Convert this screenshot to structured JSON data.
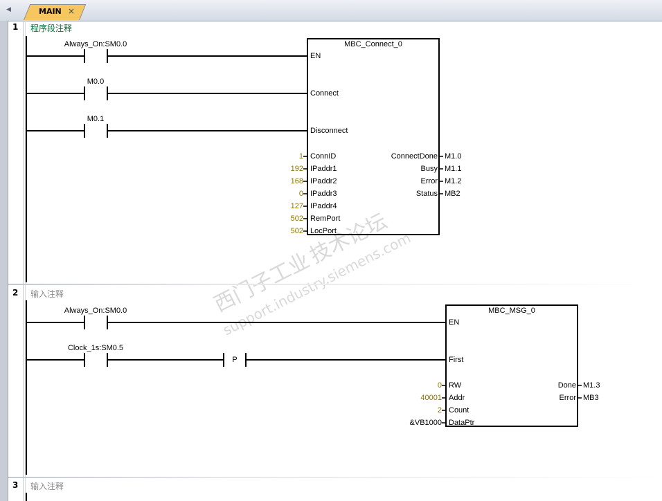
{
  "editor": {
    "tab_label": "MAIN",
    "tab_close": "×",
    "scroll_left": "◀"
  },
  "watermark": {
    "line1": "西门子工业",
    "line2": "技术论坛",
    "line3": "support.industry.siemens.com"
  },
  "network1": {
    "number": "1",
    "comment": "程序段注释",
    "contacts": [
      "Always_On:SM0.0",
      "M0.0",
      "M0.1"
    ],
    "block": {
      "title": "MBC_Connect_0",
      "en": "EN",
      "connect": "Connect",
      "disconnect": "Disconnect",
      "inputs": [
        {
          "pin": "ConnID",
          "value": "1"
        },
        {
          "pin": "IPaddr1",
          "value": "192"
        },
        {
          "pin": "IPaddr2",
          "value": "168"
        },
        {
          "pin": "IPaddr3",
          "value": "0"
        },
        {
          "pin": "IPaddr4",
          "value": "127"
        },
        {
          "pin": "RemPort",
          "value": "502"
        },
        {
          "pin": "LocPort",
          "value": "502"
        }
      ],
      "outputs": [
        {
          "pin": "ConnectDone",
          "value": "M1.0"
        },
        {
          "pin": "Busy",
          "value": "M1.1"
        },
        {
          "pin": "Error",
          "value": "M1.2"
        },
        {
          "pin": "Status",
          "value": "MB2"
        }
      ]
    }
  },
  "network2": {
    "number": "2",
    "comment": "输入注释",
    "contacts": [
      "Always_On:SM0.0",
      "Clock_1s:SM0.5"
    ],
    "pulse_label": "P",
    "block": {
      "title": "MBC_MSG_0",
      "en": "EN",
      "first": "First",
      "inputs": [
        {
          "pin": "RW",
          "value": "0",
          "color": "#8a7400"
        },
        {
          "pin": "Addr",
          "value": "40001",
          "color": "#8a7400"
        },
        {
          "pin": "Count",
          "value": "2",
          "color": "#8a7400"
        },
        {
          "pin": "DataPtr",
          "value": "&VB1000",
          "color": "#000000"
        }
      ],
      "outputs": [
        {
          "pin": "Done",
          "value": "M1.3"
        },
        {
          "pin": "Error",
          "value": "MB3"
        }
      ]
    }
  },
  "network3": {
    "number": "3",
    "comment": "输入注释"
  },
  "colors": {
    "comment_network1": "#00733a",
    "comment_other": "#8a8a8a",
    "constant": "#8a7400",
    "tab_active": "#f6c760"
  }
}
